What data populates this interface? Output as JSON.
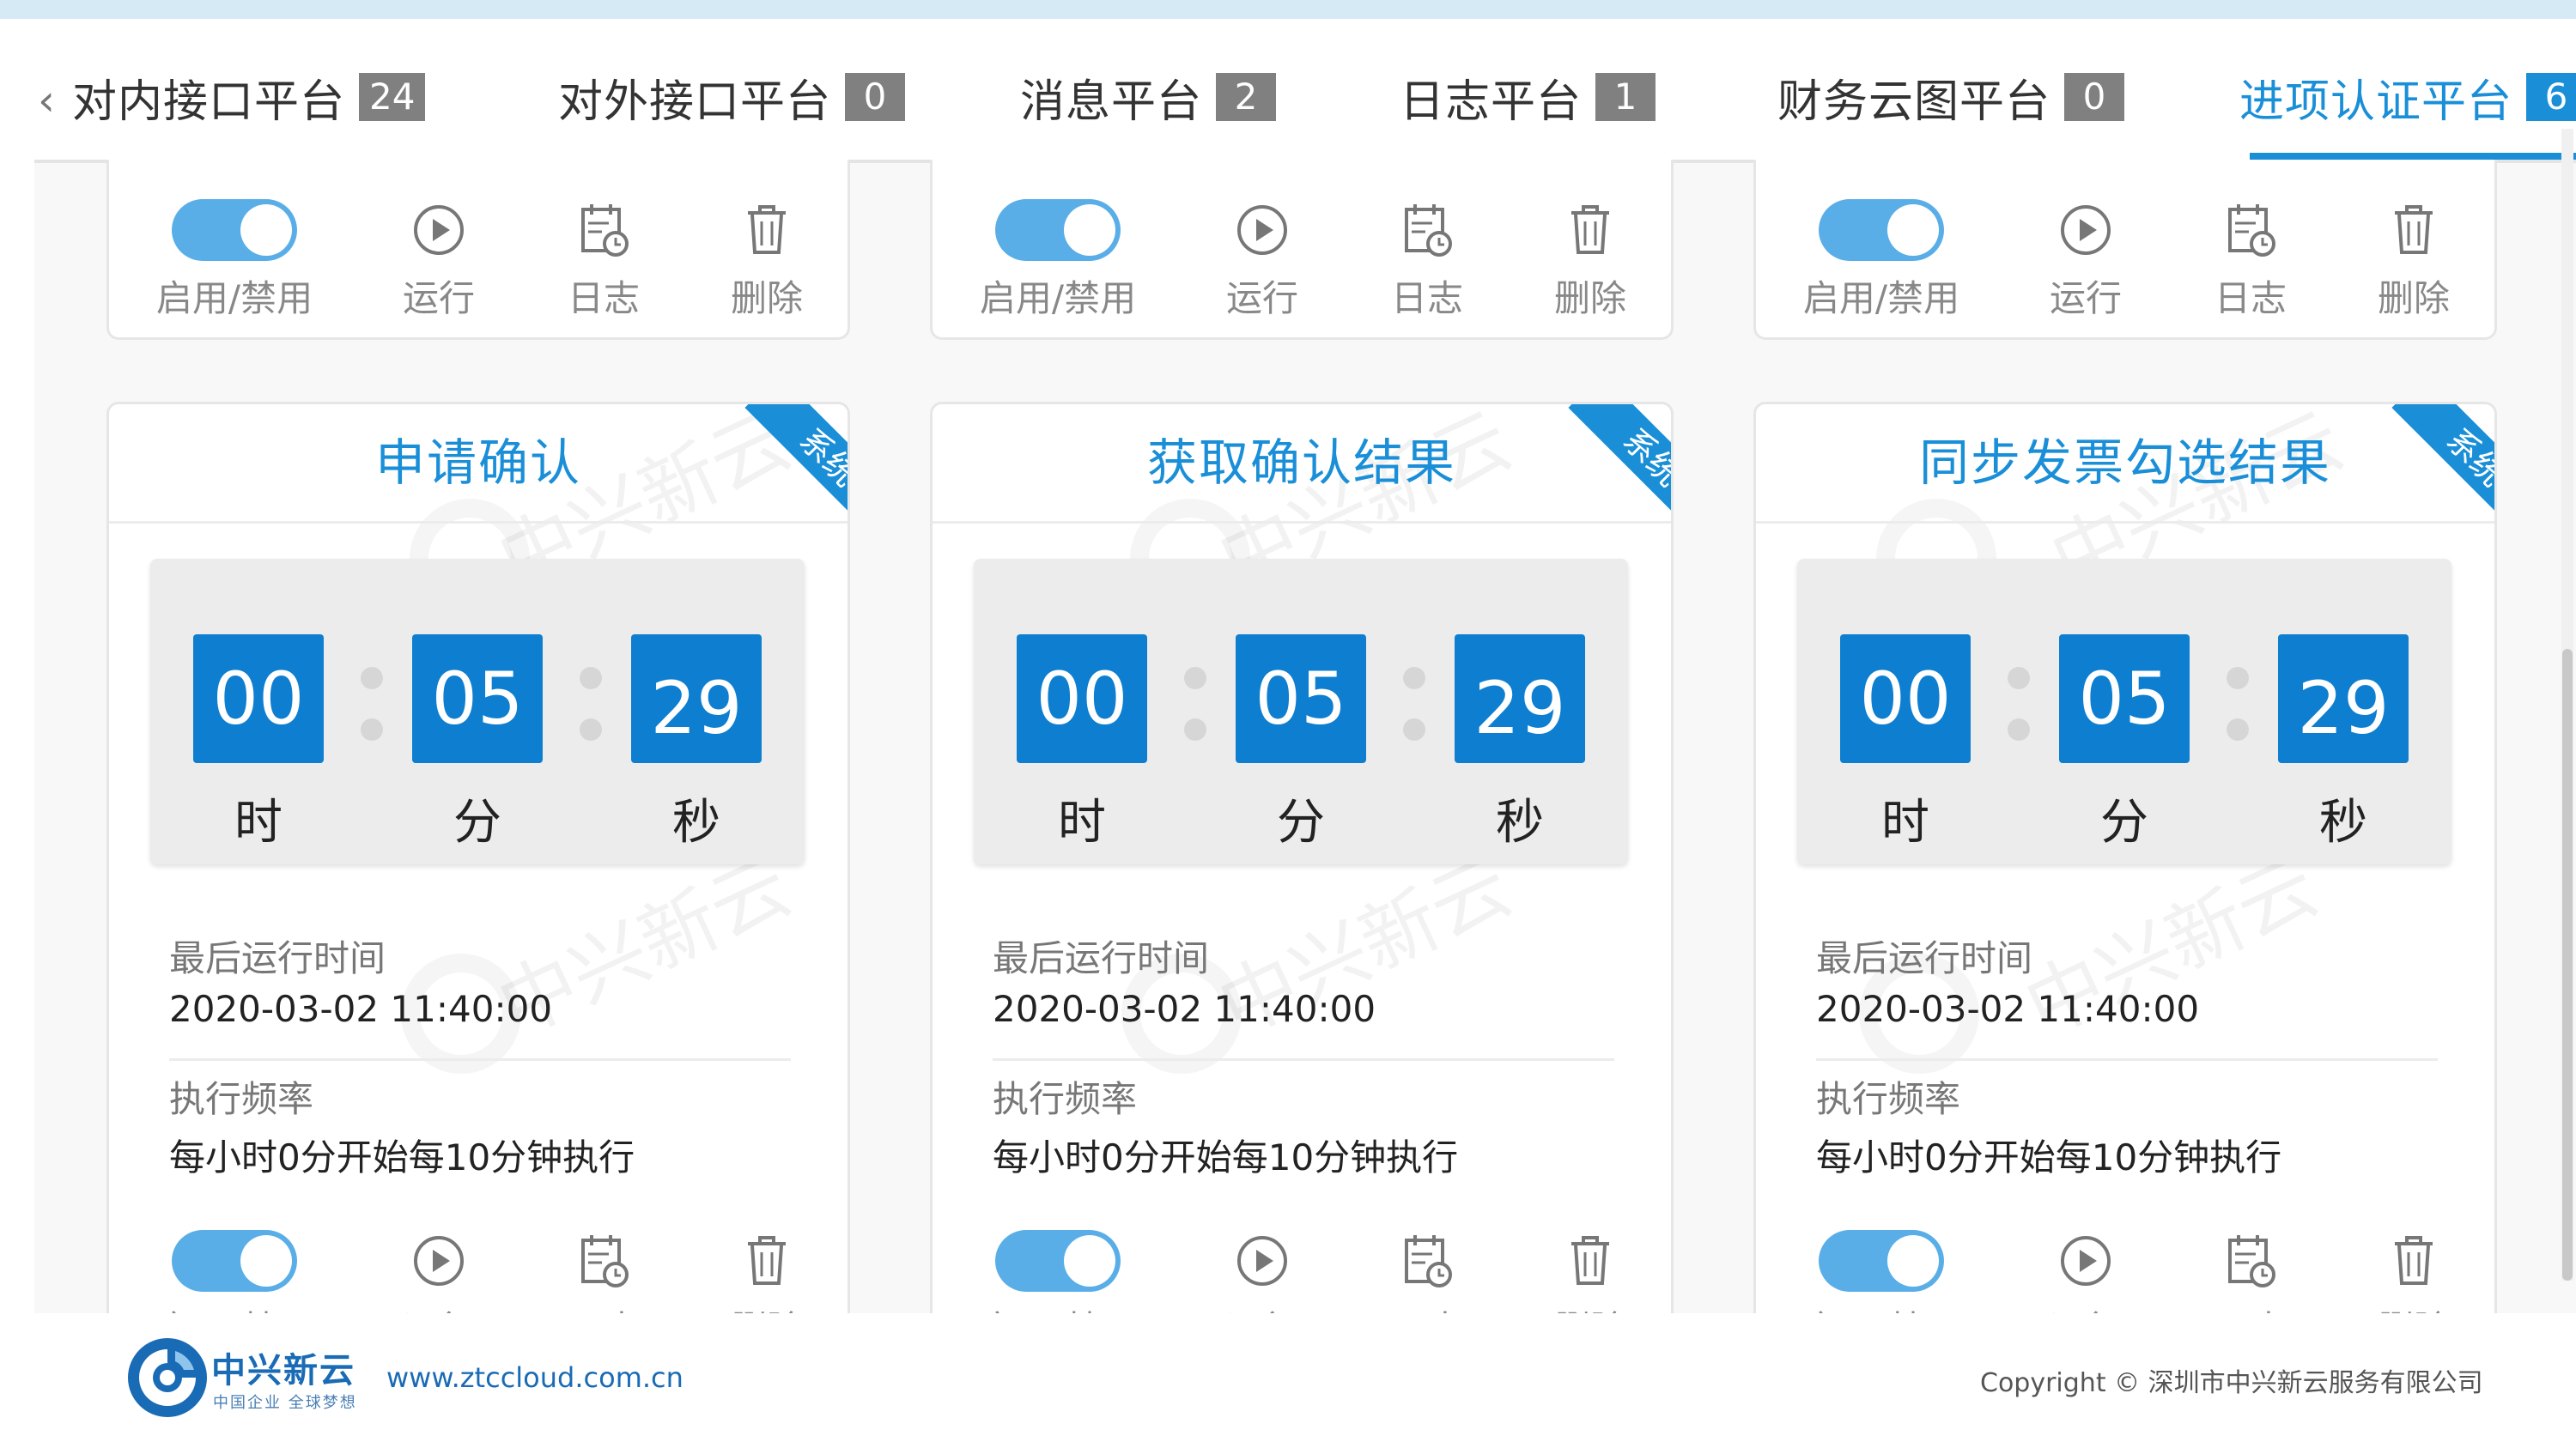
{
  "tabs": [
    {
      "label": "对内接口平台",
      "count": "24"
    },
    {
      "label": "对外接口平台",
      "count": "0"
    },
    {
      "label": "消息平台",
      "count": "2"
    },
    {
      "label": "日志平台",
      "count": "1"
    },
    {
      "label": "财务云图平台",
      "count": "0"
    },
    {
      "label": "进项认证平台",
      "count": "6",
      "active": true
    }
  ],
  "actions": {
    "toggle_label": "启用/禁用",
    "run_label": "运行",
    "log_label": "日志",
    "delete_label": "删除"
  },
  "ribbon_text": "系统",
  "timer_units": {
    "h": "时",
    "m": "分",
    "s": "秒"
  },
  "info_labels": {
    "last_run": "最后运行时间",
    "frequency": "执行频率"
  },
  "cards": [
    {
      "title": "申请确认",
      "hours": "00",
      "minutes": "05",
      "seconds": "29",
      "last_run": "2020-03-02 11:40:00",
      "frequency": "每小时0分开始每10分钟执行"
    },
    {
      "title": "获取确认结果",
      "hours": "00",
      "minutes": "05",
      "seconds": "29",
      "last_run": "2020-03-02 11:40:00",
      "frequency": "每小时0分开始每10分钟执行"
    },
    {
      "title": "同步发票勾选结果",
      "hours": "00",
      "minutes": "05",
      "seconds": "29",
      "last_run": "2020-03-02 11:40:00",
      "frequency": "每小时0分开始每10分钟执行"
    }
  ],
  "watermark_text": "中兴新云",
  "footer": {
    "brand_name": "中兴新云",
    "brand_slogan": "中国企业 全球梦想",
    "url": "www.ztccloud.com.cn",
    "copyright": "Copyright © 深圳市中兴新云服务有限公司"
  },
  "colors": {
    "accent": "#1a8fd8",
    "badge": "#808080",
    "toggle_on": "#5aaee8"
  }
}
